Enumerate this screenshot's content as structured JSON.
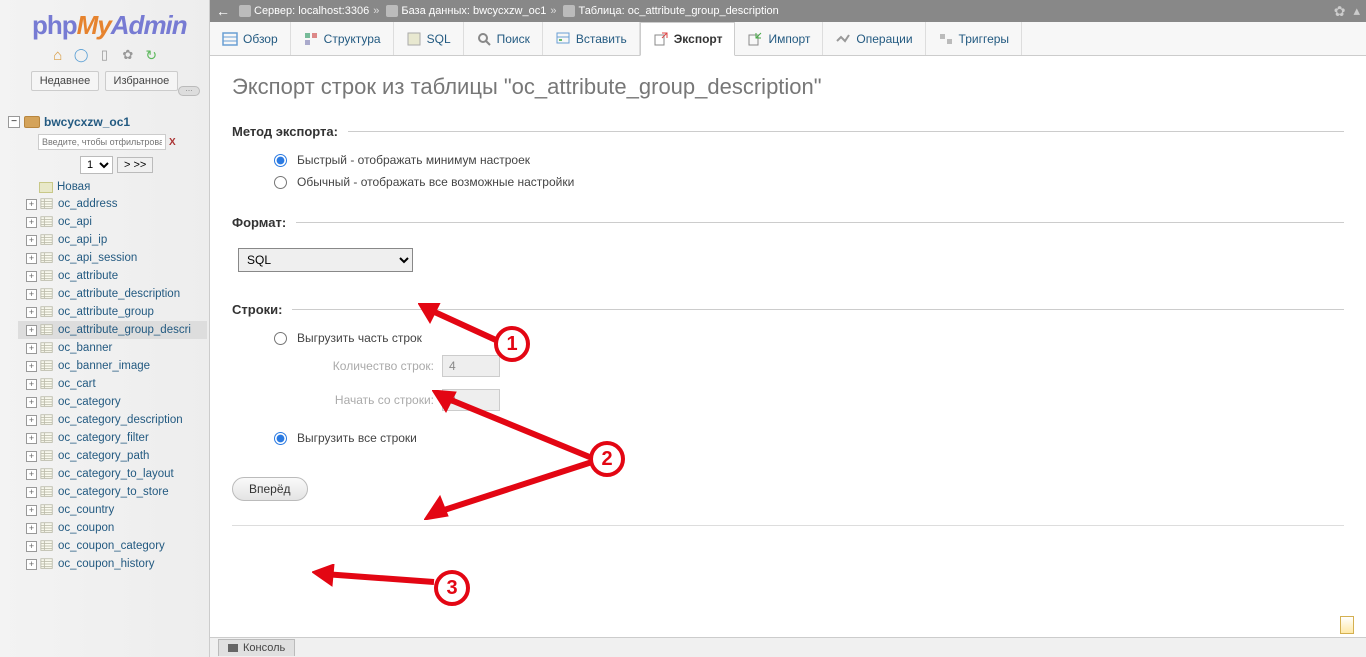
{
  "logo": {
    "p1": "php",
    "p2": "My",
    "p3": "Admin"
  },
  "recent_fav": {
    "recent": "Недавнее",
    "favorite": "Избранное"
  },
  "tree": {
    "db_name": "bwcycxzw_oc1",
    "filter_placeholder": "Введите, чтобы отфильтровать и",
    "page_sel": "1",
    "next_btn": "> >>",
    "new_label": "Новая",
    "tables": [
      "oc_address",
      "oc_api",
      "oc_api_ip",
      "oc_api_session",
      "oc_attribute",
      "oc_attribute_description",
      "oc_attribute_group",
      "oc_attribute_group_descri",
      "oc_banner",
      "oc_banner_image",
      "oc_cart",
      "oc_category",
      "oc_category_description",
      "oc_category_filter",
      "oc_category_path",
      "oc_category_to_layout",
      "oc_category_to_store",
      "oc_country",
      "oc_coupon",
      "oc_coupon_category",
      "oc_coupon_history"
    ],
    "selected_index": 7
  },
  "breadcrumb": {
    "server_label": "Сервер:",
    "server_val": "localhost:3306",
    "db_label": "База данных:",
    "db_val": "bwcycxzw_oc1",
    "table_label": "Таблица:",
    "table_val": "oc_attribute_group_description"
  },
  "tabs": {
    "browse": "Обзор",
    "structure": "Структура",
    "sql": "SQL",
    "search": "Поиск",
    "insert": "Вставить",
    "export": "Экспорт",
    "import": "Импорт",
    "operations": "Операции",
    "triggers": "Триггеры"
  },
  "page_title": "Экспорт строк из таблицы \"oc_attribute_group_description\"",
  "export_method": {
    "legend": "Метод экспорта:",
    "quick": "Быстрый - отображать минимум настроек",
    "custom": "Обычный - отображать все возможные настройки"
  },
  "format": {
    "legend": "Формат:",
    "selected": "SQL"
  },
  "rows": {
    "legend": "Строки:",
    "dump_some": "Выгрузить часть строк",
    "count_label": "Количество строк:",
    "count_val": "4",
    "start_label": "Начать со строки:",
    "start_val": "0",
    "dump_all": "Выгрузить все строки"
  },
  "go_button": "Вперёд",
  "console": "Консоль",
  "annotations": {
    "n1": "1",
    "n2": "2",
    "n3": "3"
  }
}
